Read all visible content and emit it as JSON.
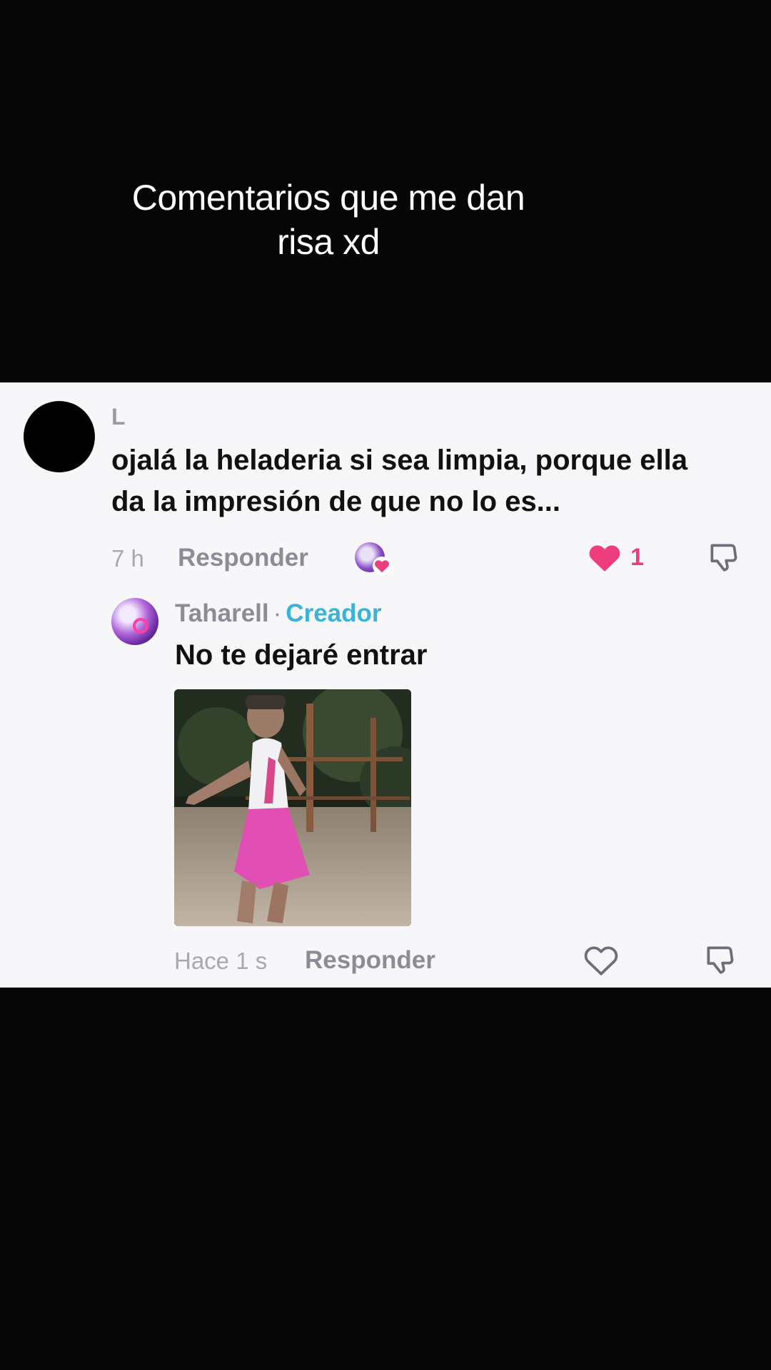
{
  "overlay": {
    "caption": "Comentarios que me dan risa xd"
  },
  "comment": {
    "username": "L",
    "text": "ojalá la heladeria si sea limpia, porque ella da la impresión de que no lo es...",
    "time": "7 h",
    "reply_label": "Responder",
    "like_count": "1",
    "liked": true
  },
  "reply": {
    "username": "Taharell",
    "separator": "·",
    "badge": "Creador",
    "text": "No te dejaré entrar",
    "time": "Hace 1 s",
    "reply_label": "Responder",
    "liked": false
  },
  "colors": {
    "like_active": "#ee3d7e",
    "creator_badge": "#3ab3d6",
    "card_bg": "#f7f7fa",
    "video_bg": "#060606"
  },
  "icons": {
    "like": "heart-icon",
    "dislike": "thumbs-down-icon"
  }
}
